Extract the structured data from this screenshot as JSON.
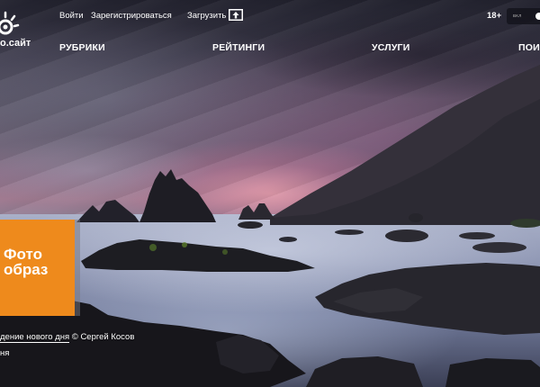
{
  "header": {
    "logo_text": "о.сайт",
    "login_label": "Войти",
    "register_label": "Зарегистрироваться",
    "upload_label": "Загрузить",
    "age_badge": "18+",
    "toggle_label": "ВКЛ"
  },
  "nav": {
    "items": [
      {
        "label": "РУБРИКИ"
      },
      {
        "label": "РЕЙТИНГИ"
      },
      {
        "label": "УСЛУГИ"
      },
      {
        "label": "ПОИ"
      }
    ]
  },
  "promo": {
    "line1": "Фото",
    "line2": "образ"
  },
  "caption": {
    "title": "дение нового дня",
    "copyright": "© Сергей Косов",
    "line2": "ня"
  },
  "icons": {
    "logo": "camera-sun-icon",
    "upload": "upload-icon"
  },
  "colors": {
    "promo": "#ee8a1c",
    "text": "#ffffff"
  }
}
